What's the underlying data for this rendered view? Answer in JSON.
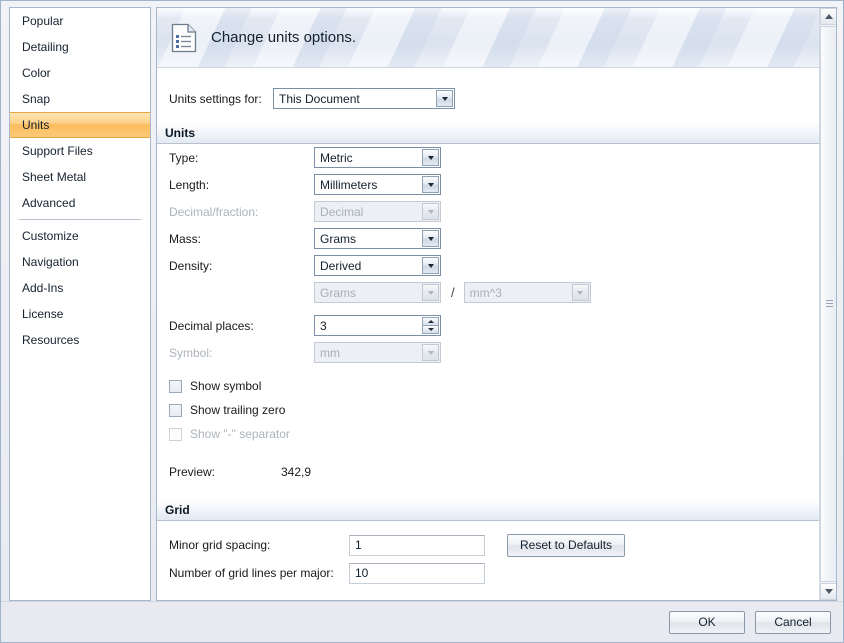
{
  "sidebar": {
    "items": [
      {
        "label": "Popular",
        "selected": false,
        "separator_after": false
      },
      {
        "label": "Detailing",
        "selected": false,
        "separator_after": false
      },
      {
        "label": "Color",
        "selected": false,
        "separator_after": false
      },
      {
        "label": "Snap",
        "selected": false,
        "separator_after": false
      },
      {
        "label": "Units",
        "selected": true,
        "separator_after": false
      },
      {
        "label": "Support Files",
        "selected": false,
        "separator_after": false
      },
      {
        "label": "Sheet Metal",
        "selected": false,
        "separator_after": false
      },
      {
        "label": "Advanced",
        "selected": false,
        "separator_after": true
      },
      {
        "label": "Customize",
        "selected": false,
        "separator_after": false
      },
      {
        "label": "Navigation",
        "selected": false,
        "separator_after": false
      },
      {
        "label": "Add-Ins",
        "selected": false,
        "separator_after": false
      },
      {
        "label": "License",
        "selected": false,
        "separator_after": false
      },
      {
        "label": "Resources",
        "selected": false,
        "separator_after": false
      }
    ]
  },
  "banner": {
    "title": "Change units options.",
    "icon": "document-lines-icon"
  },
  "top": {
    "units_settings_for_label": "Units settings for:",
    "units_settings_for_value": "This Document"
  },
  "units_section": {
    "header": "Units",
    "rows": [
      {
        "label": "Type:",
        "value": "Metric",
        "disabled": false
      },
      {
        "label": "Length:",
        "value": "Millimeters",
        "disabled": false
      },
      {
        "label": "Decimal/fraction:",
        "value": "Decimal",
        "disabled": true
      },
      {
        "label": "Mass:",
        "value": "Grams",
        "disabled": false
      },
      {
        "label": "Density:",
        "value": "Derived",
        "disabled": false
      }
    ],
    "density_pair": {
      "numerator": "Grams",
      "separator": "/",
      "denominator": "mm^3",
      "disabled": true
    },
    "decimal_places": {
      "label": "Decimal places:",
      "value": "3"
    },
    "symbol": {
      "label": "Symbol:",
      "value": "mm",
      "disabled": true
    },
    "checkboxes": [
      {
        "label": "Show symbol",
        "checked": false,
        "disabled": false
      },
      {
        "label": "Show trailing zero",
        "checked": false,
        "disabled": false
      },
      {
        "label": "Show \"-\" separator",
        "checked": false,
        "disabled": true
      }
    ],
    "preview": {
      "label": "Preview:",
      "value": "342,9"
    }
  },
  "grid_section": {
    "header": "Grid",
    "minor_grid_spacing_label": "Minor grid spacing:",
    "minor_grid_spacing_value": "1",
    "lines_per_major_label": "Number of grid lines per major:",
    "lines_per_major_value": "10",
    "reset_button": "Reset to Defaults"
  },
  "footer": {
    "ok": "OK",
    "cancel": "Cancel"
  },
  "scrollbar": {
    "up_icon": "caret-up-icon",
    "down_icon": "caret-down-icon"
  },
  "colors": {
    "selection_orange": "#fbbc5c",
    "panel_border": "#a7b8cc",
    "banner_blue": "#dbe3f0"
  }
}
